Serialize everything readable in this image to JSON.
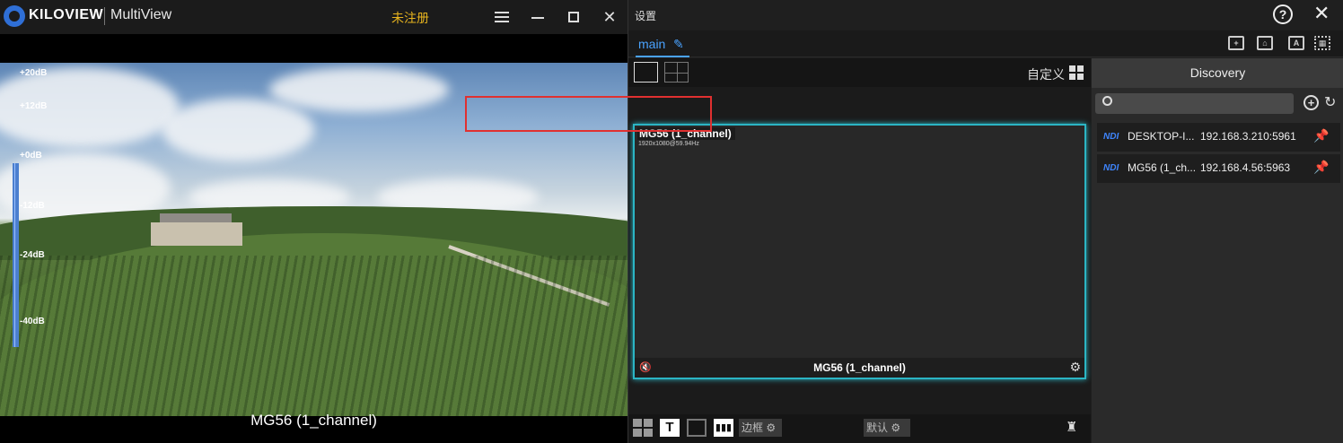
{
  "player": {
    "brand": "KILOVIEW",
    "app_name": "MultiView",
    "register_status": "未注册",
    "db_levels": [
      "+20dB",
      "+12dB",
      "+0dB",
      "-12dB",
      "-24dB",
      "-40dB"
    ],
    "video_title": "MG56 (1_channel)",
    "icons": [
      "menu-icon",
      "minimize-icon",
      "maximize-icon",
      "close-icon"
    ]
  },
  "settings": {
    "title": "设置",
    "tab": "main",
    "custom_label": "自定义",
    "cell": {
      "name": "MG56 (1_channel)",
      "resolution": "1920x1080@59.94Hz",
      "label": "MG56 (1_channel)"
    },
    "toolbar": {
      "text_btn": "T",
      "border_label": "边框",
      "default_label": "默认"
    },
    "top_icons": [
      "add-window-icon",
      "home-icon",
      "text-icon",
      "qr-icon"
    ]
  },
  "discovery": {
    "title": "Discovery",
    "search_placeholder": "",
    "sources": [
      {
        "protocol": "NDI",
        "name": "DESKTOP-I...",
        "ip": "192.168.3.210:5961"
      },
      {
        "protocol": "NDI",
        "name": "MG56 (1_ch...",
        "ip": "192.168.4.56:5963"
      }
    ]
  },
  "colors": {
    "accent_blue": "#4aa3ff",
    "selection_cyan": "#2bb5c4",
    "warning_yellow": "#e6b31e",
    "highlight_red": "#e03030"
  }
}
